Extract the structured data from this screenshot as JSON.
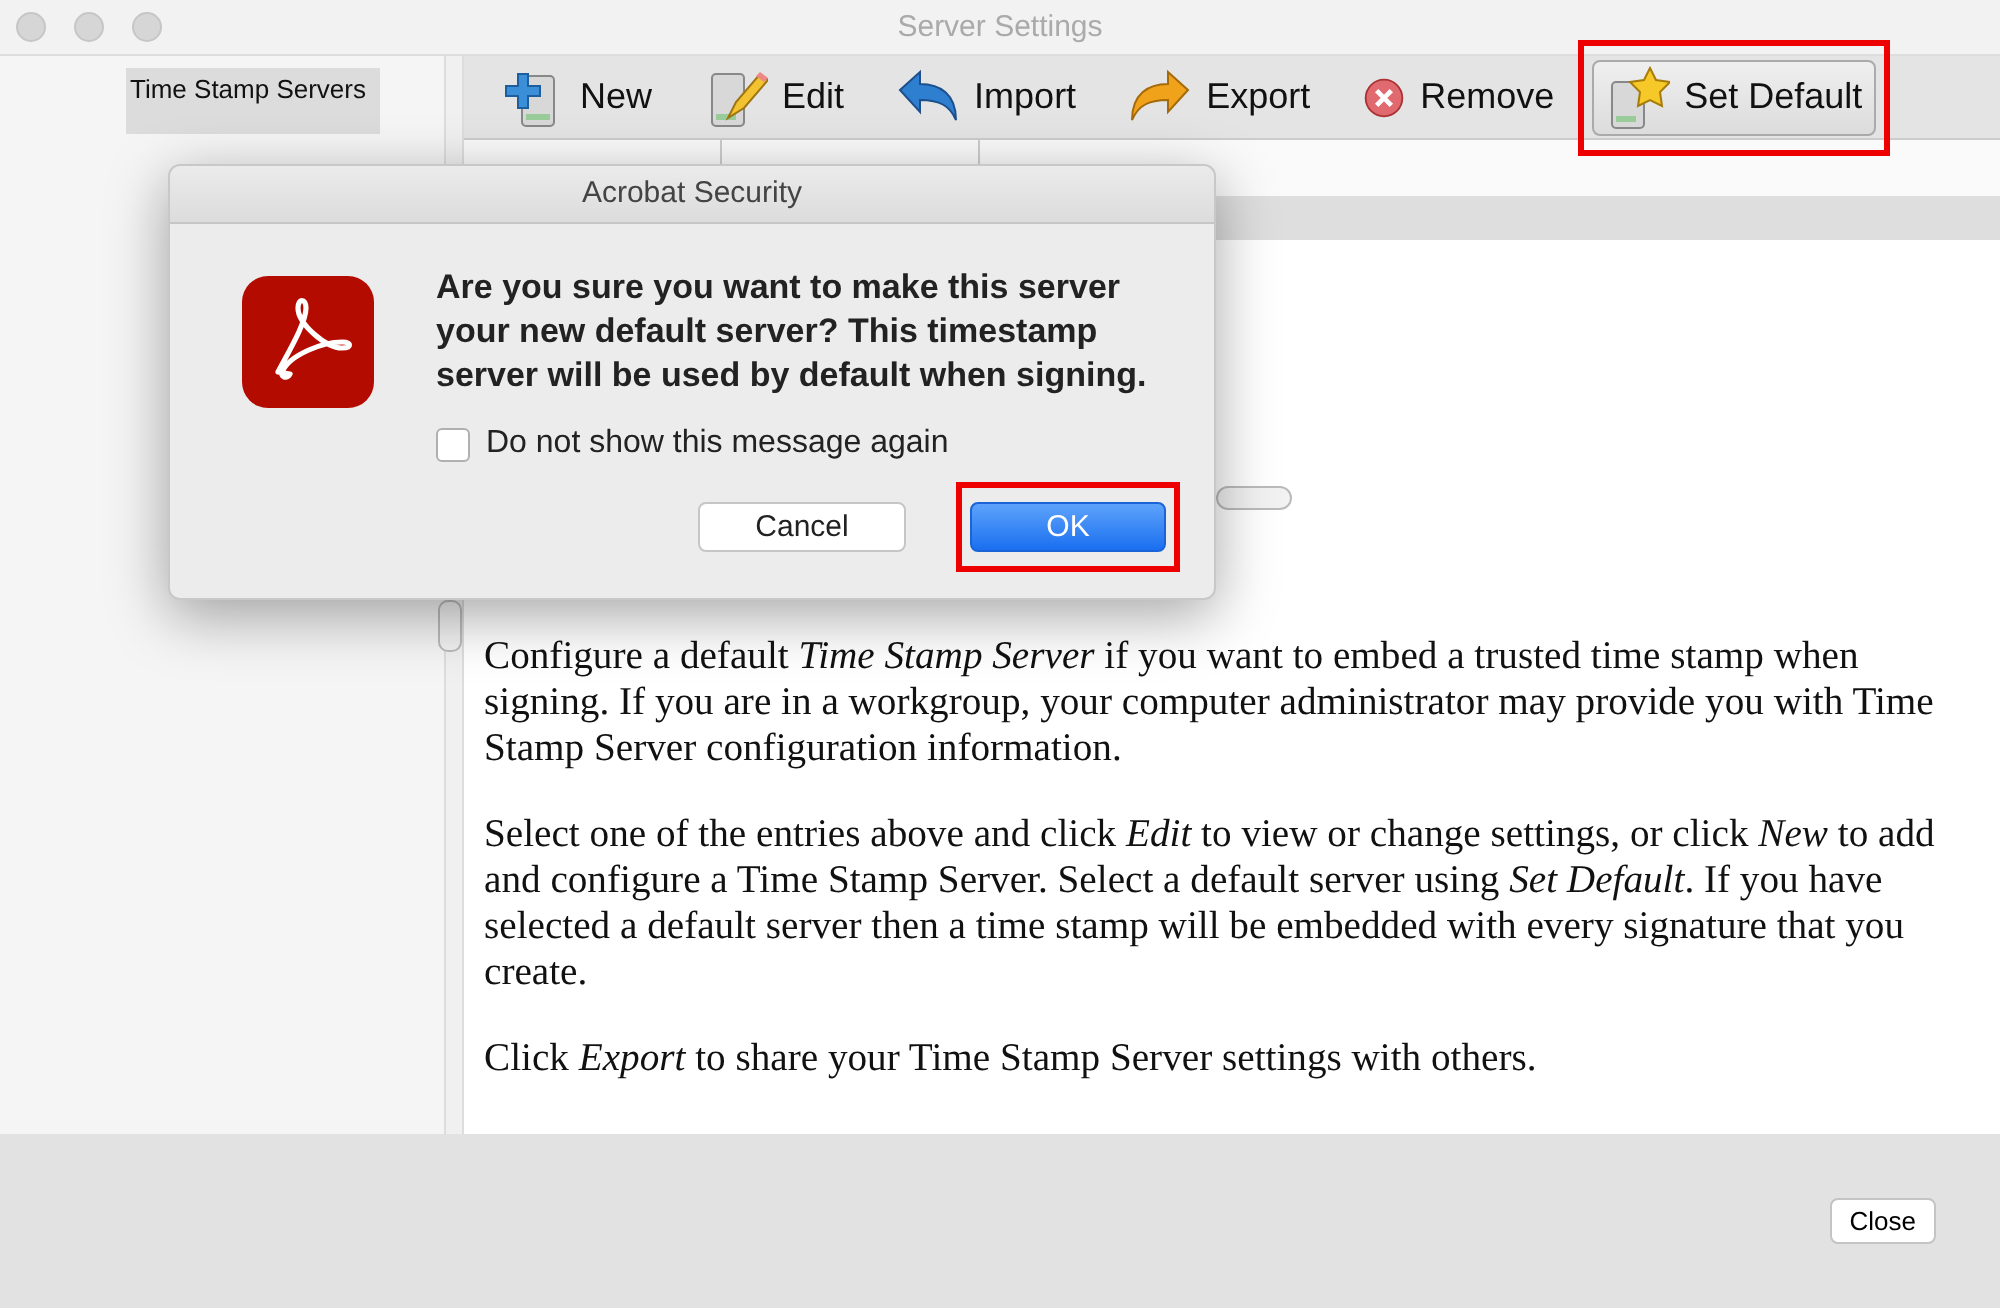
{
  "window": {
    "title": "Server Settings"
  },
  "sidebar": {
    "items": [
      {
        "label": "Time Stamp Servers",
        "selected": true
      }
    ]
  },
  "toolbar": [
    {
      "kind": "new",
      "label": "New",
      "pressed": false,
      "highlighted": false
    },
    {
      "kind": "edit",
      "label": "Edit",
      "pressed": false,
      "highlighted": false
    },
    {
      "kind": "import",
      "label": "Import",
      "pressed": false,
      "highlighted": false
    },
    {
      "kind": "export",
      "label": "Export",
      "pressed": false,
      "highlighted": false
    },
    {
      "kind": "remove",
      "label": "Remove",
      "pressed": false,
      "highlighted": false
    },
    {
      "kind": "set-default",
      "label": "Set Default",
      "pressed": true,
      "highlighted": true
    }
  ],
  "help_text": [
    "Configure a default *Time Stamp Server* if you want to embed a trusted time stamp when signing. If you are in a workgroup, your computer administrator may provide you with Time Stamp Server configuration information.",
    "Select one of the entries above and click *Edit* to view or change settings, or click *New* to add and configure a Time Stamp Server. Select a default server using *Set Default*. If you have selected a default server then a time stamp will be embedded with every signature that you create.",
    "Click *Export* to share your Time Stamp Server settings with others."
  ],
  "close_button": "Close",
  "dialog": {
    "title": "Acrobat Security",
    "message": "Are you sure you want to make this server your new default server? This timestamp server will be used by default when signing.",
    "checkbox": {
      "label": "Do not show this message again",
      "checked": false
    },
    "buttons": [
      {
        "kind": "secondary",
        "label": "Cancel",
        "highlighted": false
      },
      {
        "kind": "default",
        "label": "OK",
        "highlighted": true
      }
    ]
  }
}
